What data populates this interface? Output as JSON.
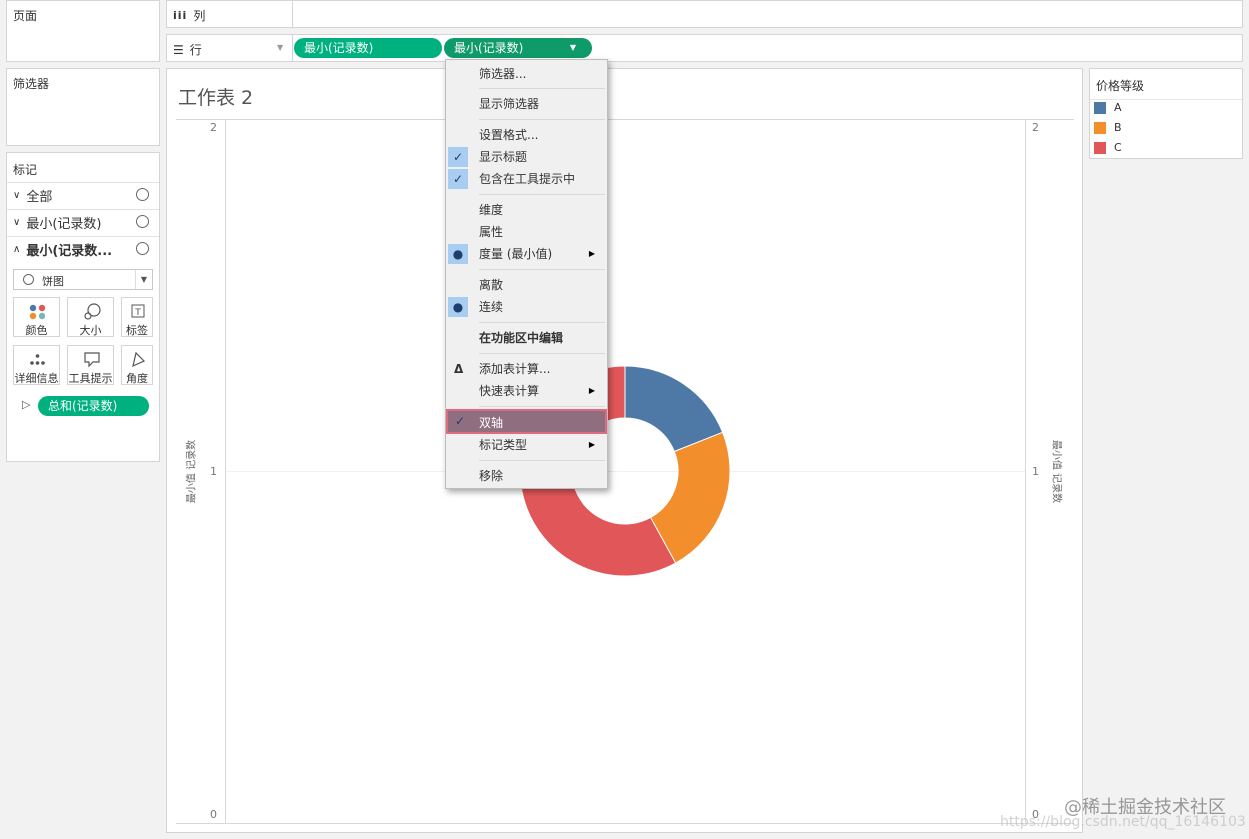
{
  "left": {
    "pages_title": "页面",
    "filters_title": "筛选器",
    "marks_title": "标记",
    "mark_rows": [
      "全部",
      "最小(记录数)",
      "最小(记录数..."
    ],
    "mark_type": "饼图",
    "mark_buttons": [
      "颜色",
      "大小",
      "标签",
      "详细信息",
      "工具提示",
      "角度"
    ],
    "angle_pill": "总和(记录数)"
  },
  "shelves": {
    "columns_label": "列",
    "rows_label": "行",
    "rows_pills": [
      "最小(记录数)",
      "最小(记录数)"
    ]
  },
  "sheet": {
    "title": "工作表 2",
    "y_axis_title": "最小值 记录数",
    "y_ticks": [
      "2",
      "1",
      "0"
    ]
  },
  "chart_data": {
    "type": "pie",
    "variant": "donut",
    "categories": [
      "A",
      "B",
      "C"
    ],
    "values": [
      19,
      23,
      58
    ],
    "colors": [
      "#4e79a7",
      "#f28e2b",
      "#e15759"
    ]
  },
  "legend": {
    "title": "价格等级",
    "items": [
      {
        "label": "A",
        "color": "#4e79a7"
      },
      {
        "label": "B",
        "color": "#f28e2b"
      },
      {
        "label": "C",
        "color": "#e15759"
      }
    ]
  },
  "menu": {
    "items": [
      "筛选器...",
      "显示筛选器",
      "设置格式...",
      "显示标题",
      "包含在工具提示中",
      "维度",
      "属性",
      "度量 (最小值)",
      "离散",
      "连续",
      "在功能区中编辑",
      "添加表计算...",
      "快速表计算",
      "双轴",
      "标记类型",
      "移除"
    ],
    "highlighted": "双轴"
  },
  "watermark": {
    "brand": "@稀土掘金技术社区",
    "url": "https://blog.csdn.net/qq_16146103"
  }
}
